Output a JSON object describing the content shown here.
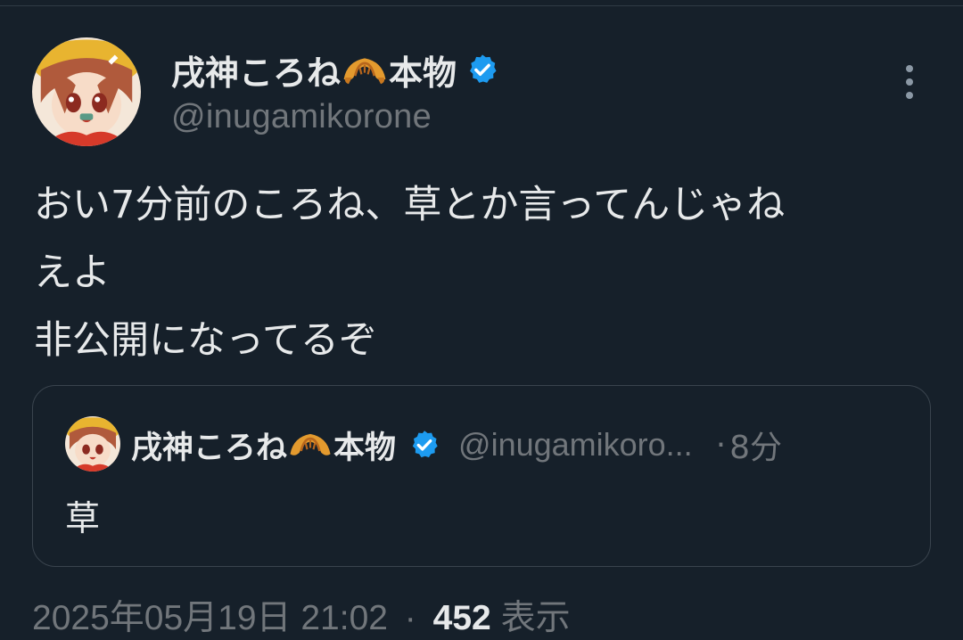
{
  "tweet": {
    "author": {
      "display_name": "戌神ころね",
      "display_name_suffix": "本物",
      "emoji_icon": "croissant-icon",
      "verified_icon": "verified-badge-icon",
      "handle": "@inugamikorone",
      "avatar_icon": "avatar-icon"
    },
    "text_lines": [
      "おい7分前のころね、草とか言ってんじゃね",
      "えよ",
      "非公開になってるぞ"
    ],
    "more_icon": "more-options-icon",
    "quoted": {
      "display_name": "戌神ころね",
      "display_name_suffix": "本物",
      "handle": "@inugamikoro...",
      "separator": "·",
      "time": "8分",
      "text": "草"
    },
    "timestamp": "2025年05月19日 21:02",
    "meta_separator": "·",
    "views_count": "452",
    "views_label": "表示"
  },
  "colors": {
    "background": "#16202a",
    "text_primary": "#e7e9ea",
    "text_secondary": "#71767b",
    "verified_blue": "#1d9bf0",
    "border": "#3a444e"
  }
}
